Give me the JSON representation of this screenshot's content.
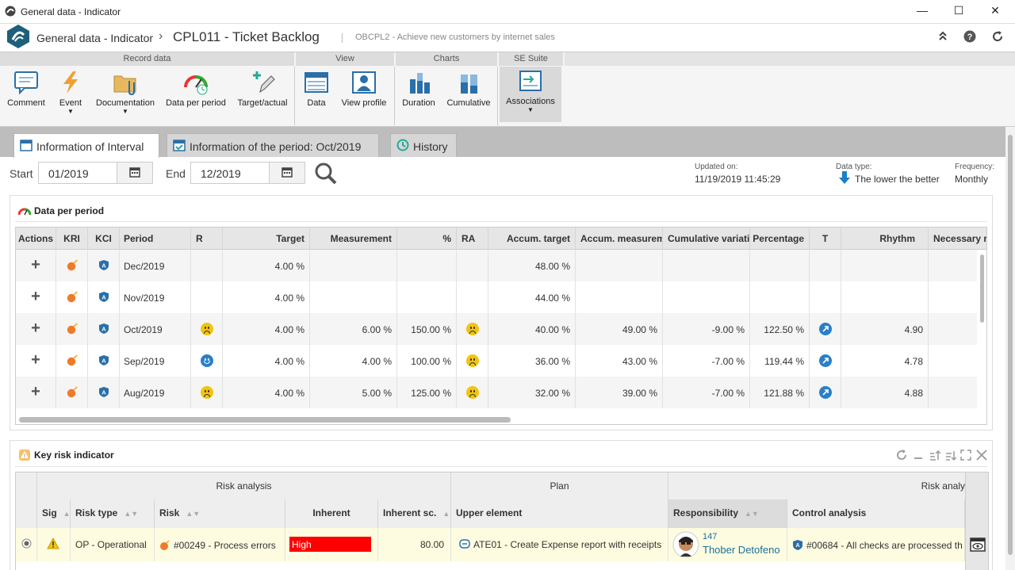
{
  "window": {
    "title": "General data - Indicator",
    "minimize": "—",
    "maximize": "☐",
    "close": "✕"
  },
  "header": {
    "module": "General data - Indicator",
    "separator": "›",
    "record": "CPL011 - Ticket Backlog",
    "subtitle": "OBCPL2 - Achieve new customers by internet sales",
    "collapse_icon": "chevrons-up-icon",
    "help_icon": "help-icon",
    "refresh_icon": "refresh-icon"
  },
  "ribbon": {
    "groups": [
      "Record data",
      "View",
      "Charts",
      "SE Suite"
    ],
    "buttons": {
      "comment": "Comment",
      "event": "Event",
      "documentation": "Documentation",
      "data_per_period": "Data per period",
      "target_actual": "Target/actual",
      "data": "Data",
      "view_profile": "View profile",
      "duration": "Duration",
      "cumulative": "Cumulative",
      "associations": "Associations"
    }
  },
  "tabs": [
    "Information of Interval",
    "Information of the period: Oct/2019",
    "History"
  ],
  "filter": {
    "start_label": "Start",
    "start_value": "01/2019",
    "end_label": "End",
    "end_value": "12/2019"
  },
  "meta": {
    "updated_label": "Updated on:",
    "updated_value": "11/19/2019 11:45:29",
    "datatype_label": "Data type:",
    "datatype_value": "The lower the better",
    "frequency_label": "Frequency:",
    "frequency_value": "Monthly"
  },
  "data_per_period": {
    "title": "Data per period",
    "columns": [
      "Actions",
      "KRI",
      "KCI",
      "Period",
      "R",
      "Target",
      "Measurement",
      "%",
      "RA",
      "Accum. target",
      "Accum. measurement",
      "Cumulative variation",
      "Percentage",
      "T",
      "Rhythm",
      "Necessary rhythm"
    ],
    "rows": [
      {
        "period": "Dec/2019",
        "r": "",
        "target": "4.00 %",
        "measurement": "",
        "pct": "",
        "ra": "",
        "accum_target": "48.00 %",
        "accum_measurement": "",
        "cum_var": "",
        "percentage": "",
        "t": "",
        "rhythm": ""
      },
      {
        "period": "Nov/2019",
        "r": "",
        "target": "4.00 %",
        "measurement": "",
        "pct": "",
        "ra": "",
        "accum_target": "44.00 %",
        "accum_measurement": "",
        "cum_var": "",
        "percentage": "",
        "t": "",
        "rhythm": ""
      },
      {
        "period": "Oct/2019",
        "r": "yellow-sad",
        "target": "4.00 %",
        "measurement": "6.00 %",
        "pct": "150.00 %",
        "ra": "yellow-sad",
        "accum_target": "40.00 %",
        "accum_measurement": "49.00 %",
        "cum_var": "-9.00 %",
        "percentage": "122.50 %",
        "t": "up-arrow",
        "rhythm": "4.90"
      },
      {
        "period": "Sep/2019",
        "r": "blue-happy",
        "target": "4.00 %",
        "measurement": "4.00 %",
        "pct": "100.00 %",
        "ra": "yellow-sad",
        "accum_target": "36.00 %",
        "accum_measurement": "43.00 %",
        "cum_var": "-7.00 %",
        "percentage": "119.44 %",
        "t": "up-arrow",
        "rhythm": "4.78"
      },
      {
        "period": "Aug/2019",
        "r": "yellow-sad",
        "target": "4.00 %",
        "measurement": "5.00 %",
        "pct": "125.00 %",
        "ra": "yellow-sad",
        "accum_target": "32.00 %",
        "accum_measurement": "39.00 %",
        "cum_var": "-7.00 %",
        "percentage": "121.88 %",
        "t": "up-arrow",
        "rhythm": "4.88"
      }
    ]
  },
  "kri": {
    "title": "Key risk indicator",
    "groups": [
      "Risk analysis",
      "Plan",
      "Risk analy"
    ],
    "columns": [
      "Sig",
      "Risk type",
      "Risk",
      "Inherent",
      "Inherent sc.",
      "Upper element",
      "Responsibility",
      "Control analysis"
    ],
    "row": {
      "risk_type": "OP - Operational",
      "risk": "#00249 - Process errors",
      "inherent": "High",
      "inherent_color": "#ff0000",
      "inherent_score": "80.00",
      "upper_element": "ATE01 - Create Expense report with receipts",
      "resp_id": "147",
      "resp_name": "Thober Detofeno",
      "control": "#00684 - All checks are processed th"
    }
  },
  "colors": {
    "accent": "#1a6f9c",
    "brand": "#1e5f7a",
    "high": "#ff0000"
  }
}
